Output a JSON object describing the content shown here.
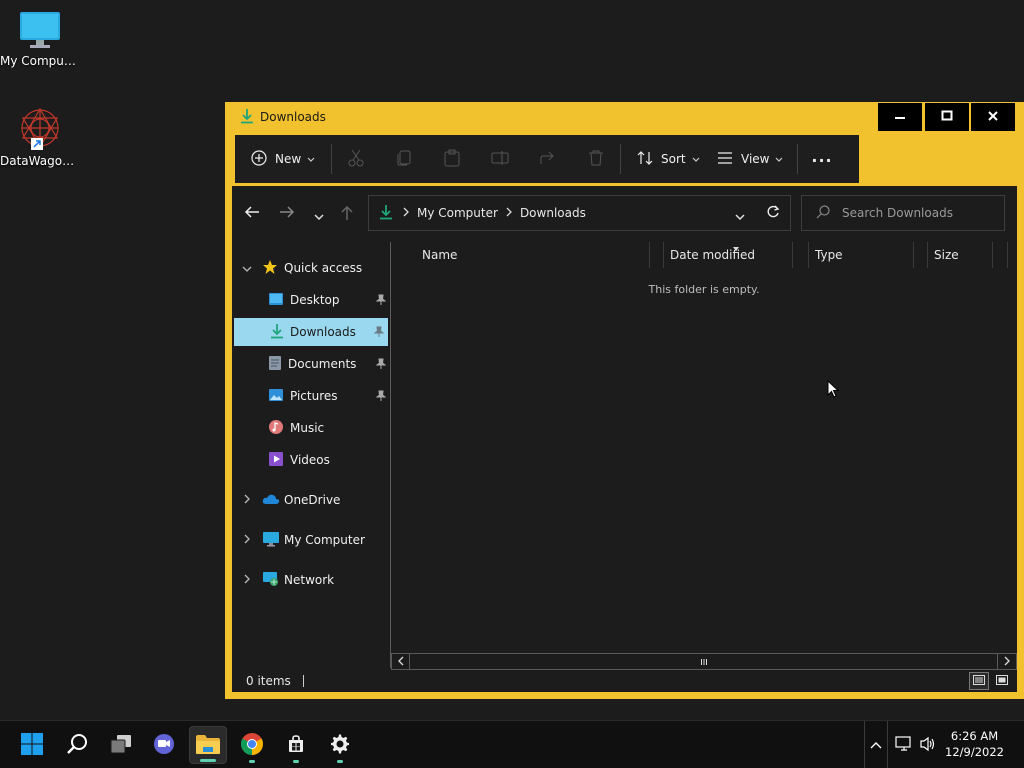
{
  "desktop": {
    "icons": [
      {
        "label": "My Computer",
        "icon": "monitor-icon"
      },
      {
        "label": "DataWagon...",
        "icon": "datawagon-shortcut-icon"
      }
    ]
  },
  "window": {
    "title": "Downloads",
    "accent_color": "#f2c12e",
    "controls": {
      "minimize": "minimize",
      "maximize": "maximize",
      "close": "close"
    }
  },
  "toolbar": {
    "new_label": "New",
    "sort_label": "Sort",
    "view_label": "View",
    "more_label": "..."
  },
  "address": {
    "segments": [
      "My Computer",
      "Downloads"
    ],
    "search_placeholder": "Search Downloads"
  },
  "nav": {
    "quick_access": "Quick access",
    "items": [
      {
        "label": "Desktop",
        "pinned": true
      },
      {
        "label": "Downloads",
        "pinned": true,
        "selected": true
      },
      {
        "label": "Documents",
        "pinned": true
      },
      {
        "label": "Pictures",
        "pinned": true
      },
      {
        "label": "Music",
        "pinned": false
      },
      {
        "label": "Videos",
        "pinned": false
      }
    ],
    "onedrive": "OneDrive",
    "my_computer": "My Computer",
    "network": "Network"
  },
  "columns": [
    "Name",
    "Date modified",
    "Type",
    "Size"
  ],
  "content": {
    "empty_message": "This folder is empty."
  },
  "status": {
    "items_count": "0 items"
  },
  "taskbar": {
    "apps": [
      "start",
      "search",
      "task-view",
      "teams-chat",
      "file-explorer",
      "chrome",
      "store",
      "settings"
    ],
    "time": "6:26 AM",
    "date": "12/9/2022"
  }
}
